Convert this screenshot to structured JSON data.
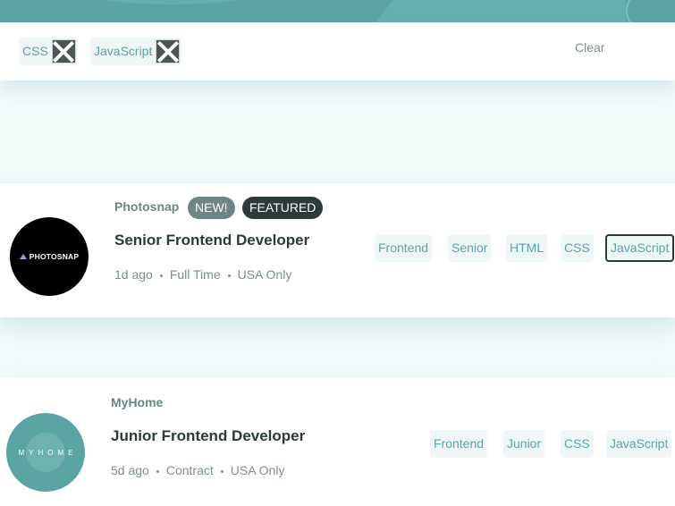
{
  "filters": {
    "active": [
      {
        "label": "CSS"
      },
      {
        "label": "JavaScript"
      }
    ],
    "clear_label": "Clear"
  },
  "jobs": [
    {
      "logo_text": "PHOTOSNAP",
      "company": "Photosnap",
      "new_badge": "NEW!",
      "featured_badge": "FEATURED",
      "position": "Senior Frontend Developer",
      "posted": "1d ago",
      "contract": "Full Time",
      "location": "USA Only",
      "tags": [
        "Frontend",
        "Senior",
        "HTML",
        "CSS",
        "JavaScript"
      ]
    },
    {
      "logo_text": "MYHOME",
      "company": "MyHome",
      "position": "Junior Frontend Developer",
      "posted": "5d ago",
      "contract": "Contract",
      "location": "USA Only",
      "tags": [
        "Frontend",
        "Junior",
        "CSS",
        "JavaScript"
      ]
    }
  ],
  "colors": {
    "primary": "#5ba4a4",
    "background": "#f2fafa",
    "tag_bg": "#eef6f6",
    "dark": "#2c3a3a",
    "grey": "#7c8f8f"
  },
  "icons": {
    "remove_filter": "close-icon",
    "separator": "dot-separator-icon"
  }
}
